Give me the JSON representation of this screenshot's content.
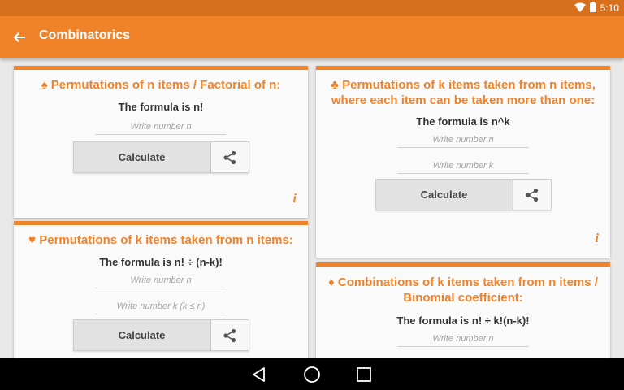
{
  "status_bar": {
    "time": "5:10",
    "icons": [
      "wifi-icon",
      "battery-icon"
    ]
  },
  "app_bar": {
    "title": "Combinatorics",
    "back_icon": "arrow-back-icon"
  },
  "colors": {
    "accent": "#f0822a",
    "status_bar": "#d86f1d",
    "background": "#e9e9e9"
  },
  "cards": {
    "perm_n": {
      "suit": "♠",
      "title": "Permutations of n items / Factorial of n:",
      "formula": "The formula is n!",
      "field_n_placeholder": "Write number n",
      "calculate_label": "Calculate",
      "info_label": "i"
    },
    "perm_k_n_repeat": {
      "suit": "♣",
      "title": "Permutations of k items taken from n items, where each item can be taken more than one:",
      "formula": "The formula is n^k",
      "field_n_placeholder": "Write number n",
      "field_k_placeholder": "Write number k",
      "calculate_label": "Calculate",
      "info_label": "i"
    },
    "perm_k_n": {
      "suit": "♥",
      "title": "Permutations of k items taken from n items:",
      "formula": "The formula is n! ÷ (n-k)!",
      "field_n_placeholder": "Write number n",
      "field_k_placeholder": "Write number k (k ≤ n)",
      "calculate_label": "Calculate"
    },
    "comb_k_n": {
      "suit": "♦",
      "title": "Combinations of k items taken from n items / Binomial coefficient:",
      "formula": "The formula is n! ÷ k!(n-k)!",
      "field_n_placeholder": "Write number n"
    }
  },
  "nav_bar": {
    "icons": [
      "back-triangle-icon",
      "home-circle-icon",
      "recents-square-icon"
    ]
  }
}
